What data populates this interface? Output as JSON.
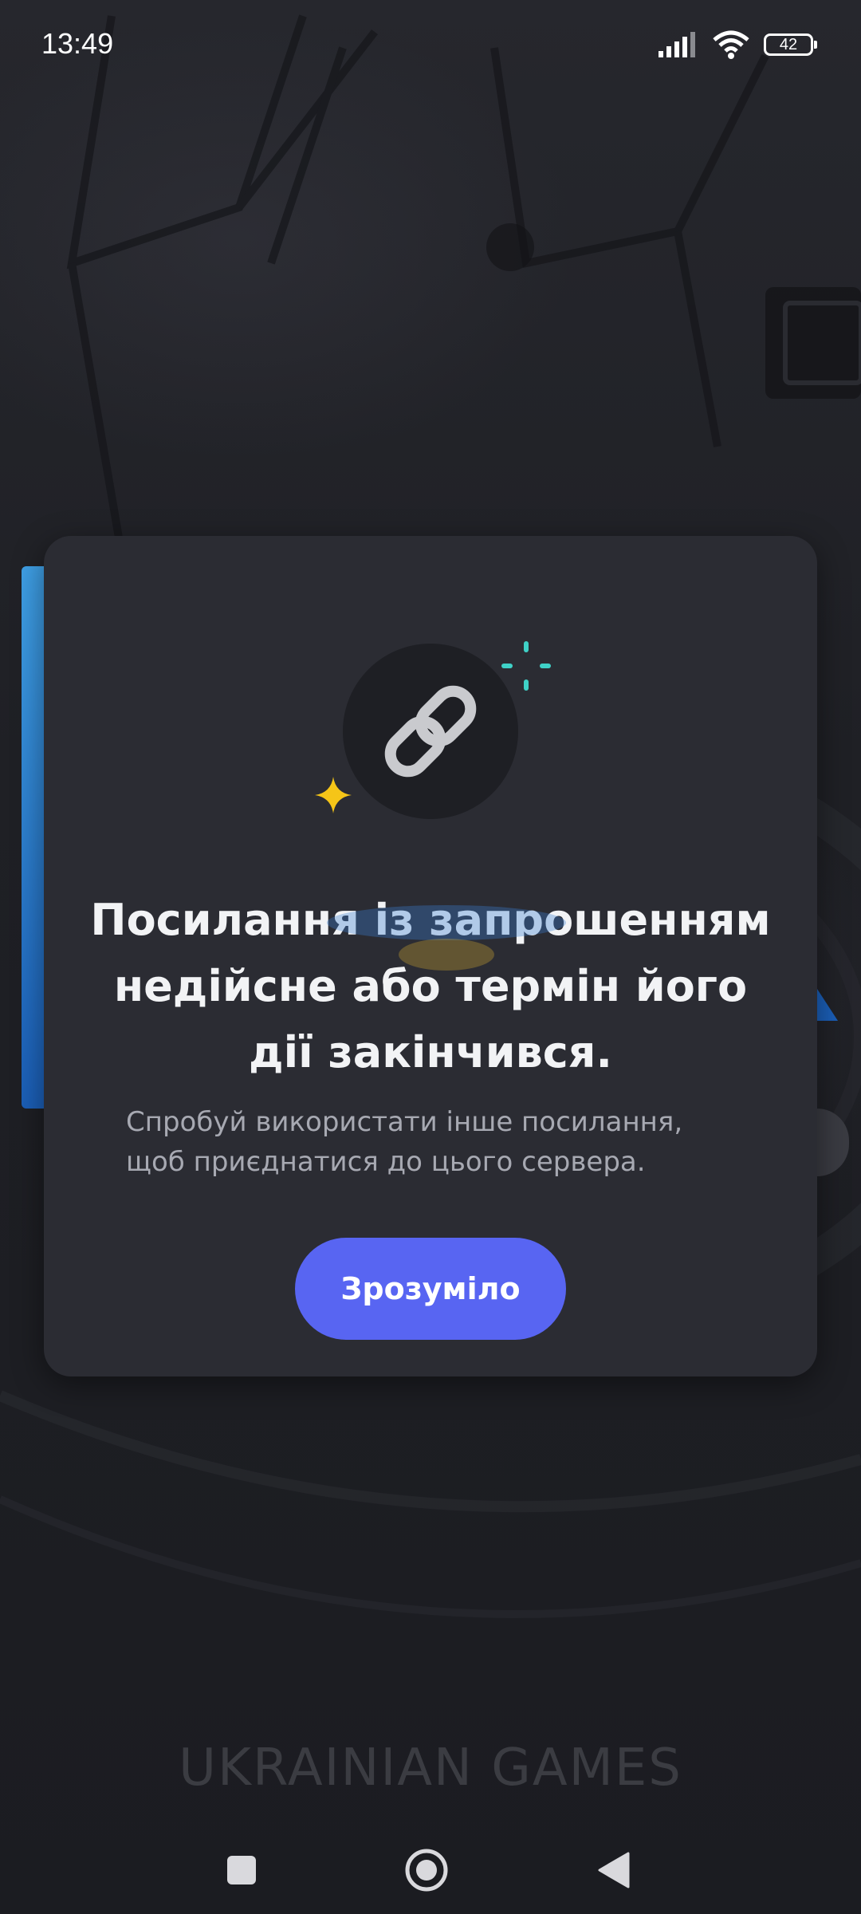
{
  "status_bar": {
    "time": "13:49",
    "battery_level": "42",
    "icons": [
      "signal-icon",
      "wifi-icon",
      "battery-icon"
    ]
  },
  "dialog": {
    "icon": "link-icon",
    "title": "Посилання із запрошенням недійсне або термін його дії закінчився.",
    "subtitle": "Спробуй використати інше посилання, щоб приєднатися до цього сервера.",
    "button_label": "Зрозуміло"
  },
  "background": {
    "watermark": "UKRAINIAN GAMES"
  },
  "nav_bar": {
    "items": [
      "recents-button",
      "home-button",
      "back-button"
    ]
  },
  "colors": {
    "accent": "#5865f2",
    "dialog_bg": "#2b2c33",
    "sparkle_yellow": "#f5c518",
    "sparkle_teal": "#3fd1c7"
  }
}
